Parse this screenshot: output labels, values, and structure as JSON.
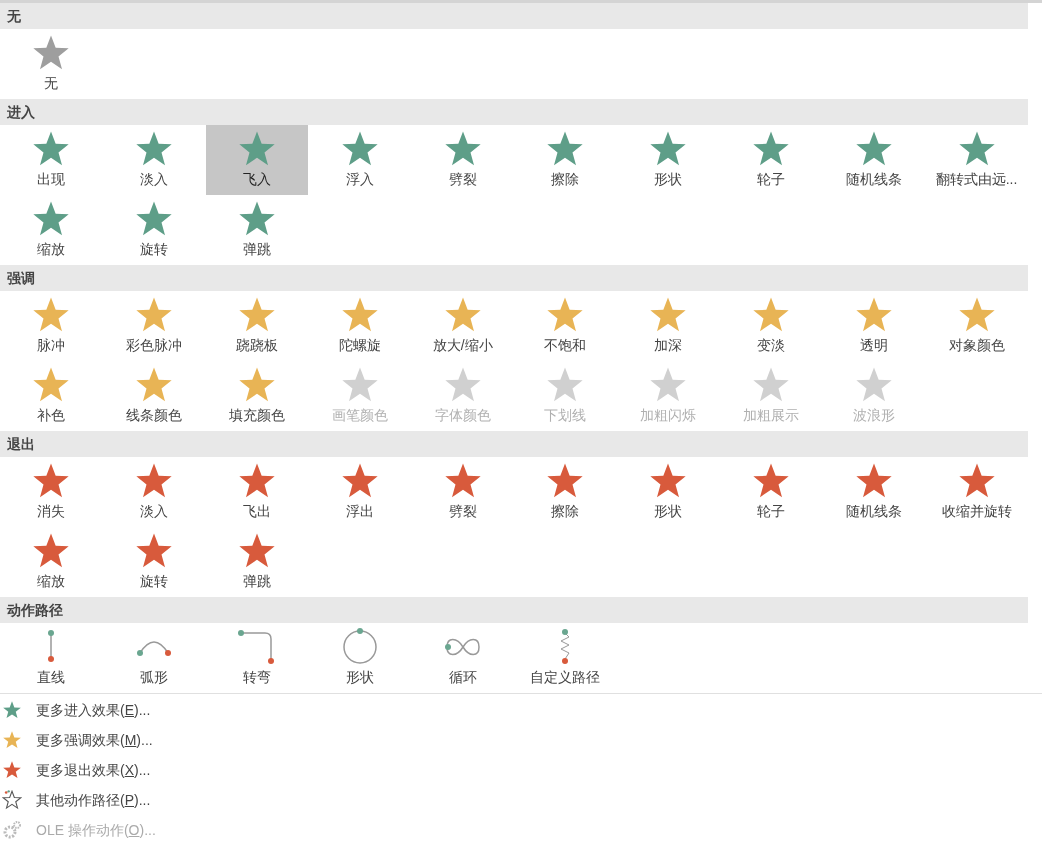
{
  "sections": [
    {
      "title": "无",
      "kind": "none",
      "items": [
        {
          "label": "无",
          "selected": false,
          "disabled": false
        }
      ]
    },
    {
      "title": "进入",
      "kind": "entrance",
      "items": [
        {
          "label": "出现",
          "selected": false,
          "disabled": false
        },
        {
          "label": "淡入",
          "selected": false,
          "disabled": false
        },
        {
          "label": "飞入",
          "selected": true,
          "disabled": false
        },
        {
          "label": "浮入",
          "selected": false,
          "disabled": false
        },
        {
          "label": "劈裂",
          "selected": false,
          "disabled": false
        },
        {
          "label": "擦除",
          "selected": false,
          "disabled": false
        },
        {
          "label": "形状",
          "selected": false,
          "disabled": false
        },
        {
          "label": "轮子",
          "selected": false,
          "disabled": false
        },
        {
          "label": "随机线条",
          "selected": false,
          "disabled": false
        },
        {
          "label": "翻转式由远...",
          "selected": false,
          "disabled": false
        },
        {
          "label": "缩放",
          "selected": false,
          "disabled": false
        },
        {
          "label": "旋转",
          "selected": false,
          "disabled": false
        },
        {
          "label": "弹跳",
          "selected": false,
          "disabled": false
        }
      ]
    },
    {
      "title": "强调",
      "kind": "emphasis",
      "items": [
        {
          "label": "脉冲",
          "selected": false,
          "disabled": false
        },
        {
          "label": "彩色脉冲",
          "selected": false,
          "disabled": false
        },
        {
          "label": "跷跷板",
          "selected": false,
          "disabled": false
        },
        {
          "label": "陀螺旋",
          "selected": false,
          "disabled": false
        },
        {
          "label": "放大/缩小",
          "selected": false,
          "disabled": false
        },
        {
          "label": "不饱和",
          "selected": false,
          "disabled": false
        },
        {
          "label": "加深",
          "selected": false,
          "disabled": false
        },
        {
          "label": "变淡",
          "selected": false,
          "disabled": false
        },
        {
          "label": "透明",
          "selected": false,
          "disabled": false
        },
        {
          "label": "对象颜色",
          "selected": false,
          "disabled": false
        },
        {
          "label": "补色",
          "selected": false,
          "disabled": false
        },
        {
          "label": "线条颜色",
          "selected": false,
          "disabled": false
        },
        {
          "label": "填充颜色",
          "selected": false,
          "disabled": false
        },
        {
          "label": "画笔颜色",
          "selected": false,
          "disabled": true
        },
        {
          "label": "字体颜色",
          "selected": false,
          "disabled": true
        },
        {
          "label": "下划线",
          "selected": false,
          "disabled": true
        },
        {
          "label": "加粗闪烁",
          "selected": false,
          "disabled": true
        },
        {
          "label": "加粗展示",
          "selected": false,
          "disabled": true
        },
        {
          "label": "波浪形",
          "selected": false,
          "disabled": true
        }
      ]
    },
    {
      "title": "退出",
      "kind": "exit",
      "items": [
        {
          "label": "消失",
          "selected": false,
          "disabled": false
        },
        {
          "label": "淡入",
          "selected": false,
          "disabled": false
        },
        {
          "label": "飞出",
          "selected": false,
          "disabled": false
        },
        {
          "label": "浮出",
          "selected": false,
          "disabled": false
        },
        {
          "label": "劈裂",
          "selected": false,
          "disabled": false
        },
        {
          "label": "擦除",
          "selected": false,
          "disabled": false
        },
        {
          "label": "形状",
          "selected": false,
          "disabled": false
        },
        {
          "label": "轮子",
          "selected": false,
          "disabled": false
        },
        {
          "label": "随机线条",
          "selected": false,
          "disabled": false
        },
        {
          "label": "收缩并旋转",
          "selected": false,
          "disabled": false
        },
        {
          "label": "缩放",
          "selected": false,
          "disabled": false
        },
        {
          "label": "旋转",
          "selected": false,
          "disabled": false
        },
        {
          "label": "弹跳",
          "selected": false,
          "disabled": false
        }
      ]
    },
    {
      "title": "动作路径",
      "kind": "path",
      "items": [
        {
          "label": "直线",
          "kind": "line",
          "selected": false,
          "disabled": false
        },
        {
          "label": "弧形",
          "kind": "arc",
          "selected": false,
          "disabled": false
        },
        {
          "label": "转弯",
          "kind": "turn",
          "selected": false,
          "disabled": false
        },
        {
          "label": "形状",
          "kind": "circle",
          "selected": false,
          "disabled": false
        },
        {
          "label": "循环",
          "kind": "loop",
          "selected": false,
          "disabled": false
        },
        {
          "label": "自定义路径",
          "kind": "custom",
          "selected": false,
          "disabled": false
        }
      ]
    }
  ],
  "menu": [
    {
      "kind": "entrance",
      "label": "更多进入效果(",
      "accelerator": "E",
      "suffix": ")...",
      "disabled": false
    },
    {
      "kind": "emphasis",
      "label": "更多强调效果(",
      "accelerator": "M",
      "suffix": ")...",
      "disabled": false
    },
    {
      "kind": "exit",
      "label": "更多退出效果(",
      "accelerator": "X",
      "suffix": ")...",
      "disabled": false
    },
    {
      "kind": "path",
      "label": "其他动作路径(",
      "accelerator": "P",
      "suffix": ")...",
      "disabled": false
    },
    {
      "kind": "ole",
      "label": "OLE 操作动作(",
      "accelerator": "O",
      "suffix": ")...",
      "disabled": true
    }
  ]
}
